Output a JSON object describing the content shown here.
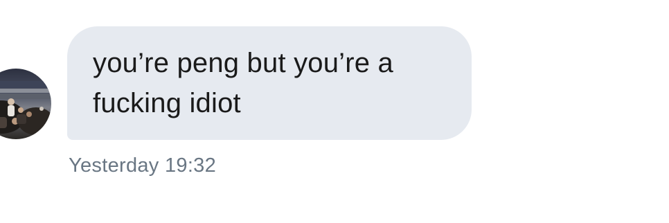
{
  "conversation": {
    "incoming_message": {
      "text": "you’re peng but you’re a fucking idiot",
      "timestamp": "Yesterday 19:32",
      "bubble_color": "#e6eaf0",
      "text_color": "#1a1a1a",
      "timestamp_color": "#697683"
    },
    "sender_avatar": {
      "icon": "user-avatar-photo"
    }
  }
}
